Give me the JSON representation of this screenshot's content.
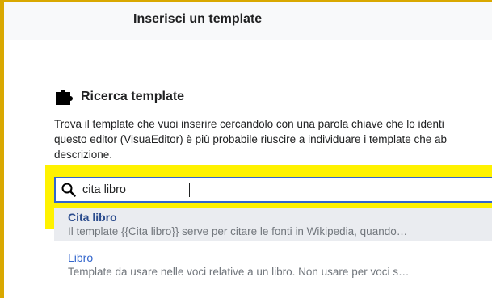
{
  "dialog": {
    "title": "Inserisci un template"
  },
  "section": {
    "heading": "Ricerca template",
    "icon": "puzzle-icon",
    "description_lines": [
      "Trova il template che vuoi inserire cercandolo con una parola chiave che lo identi",
      "questo editor (VisuaEditor) è più probabile riuscire a individuare i template che ab",
      "descrizione."
    ]
  },
  "search": {
    "value": "cita libro",
    "icon": "search-icon"
  },
  "results": [
    {
      "title": "Cita libro",
      "description": "Il template {{Cita libro}} serve per citare le fonti in Wikipedia, quando…",
      "selected": true
    },
    {
      "title": "Libro",
      "description": "Template da usare nelle voci relative a un libro. Non usare per voci s…",
      "selected": false
    }
  ],
  "colors": {
    "highlight": "#fff200",
    "link": "#3366cc",
    "frame": "#d9a800"
  }
}
